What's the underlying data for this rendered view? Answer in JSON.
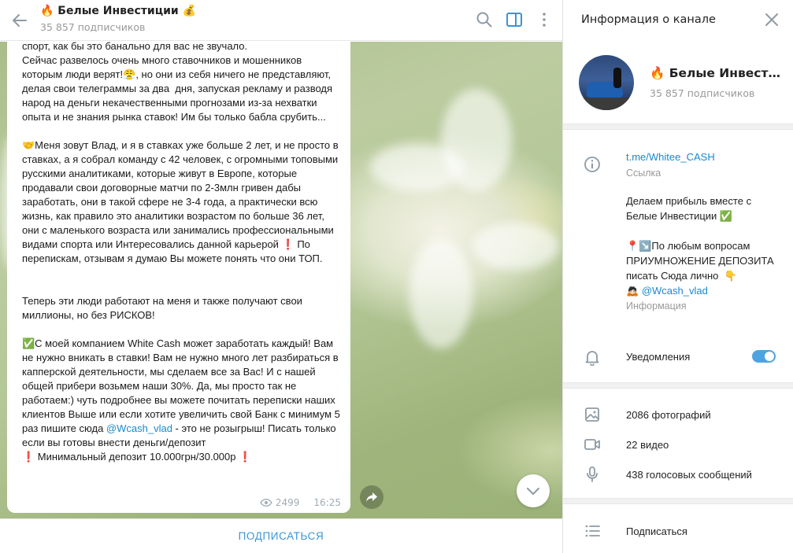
{
  "channel": {
    "title": "🔥 Белые Инвестиции 💰",
    "subscribers": "35 857 подписчиков"
  },
  "header_icons": [
    "back-arrow-icon",
    "search-icon",
    "sidebar-toggle-icon",
    "more-vertical-icon"
  ],
  "message": {
    "text": "спорт, как бы это банально для вас не звучало.\nСейчас развелось очень много ставочников и мошенников которым люди верят!😤, но они из себя ничего не представляют, делая свои телеграммы за два  дня, запуская рекламу и разводя народ на деньги некачественными прогнозами из-за нехватки опыта и не знания рынка ставок! Им бы только бабла срубить...\n\n🤝Меня зовут Влад, и я в ставках уже больше 2 лет, и не просто в ставках, а я собрал команду с 42 человек, с огромными топовыми русскими аналитиками, которые живут в Европе, которые продавали свои договорные матчи по 2-3млн гривен дабы заработать, они в такой сфере не 3-4 года, а практически всю жизнь, как правило это аналитики возрастом по больше 36 лет, они с маленького возраста или занимались профессиональными видами спорта или Интересовались данной карьерой ❗️ По перепискам, отзывам я думаю Вы можете понять что они ТОП.\n\n\nТеперь эти люди работают на меня и также получают свои миллионы, но без РИСКОВ!\n\n✅С моей компанием White Cash может заработать каждый! Вам не нужно вникать в ставки! Вам не нужно много лет разбираться в капперской деятельности, мы сделаем все за Вас! И с нашей общей прибери возьмем наши 30%. Да, мы просто так не работаем:) чуть подробнее вы можете почитать переписки наших клиентов Выше или если хотите увеличить свой Банк с минимум 5 раз пишите сюда ",
    "mention": "@Wcash_vlad",
    "text_after": " - это не розыгрыш! Писать только если вы готовы внести деньги/депозит\n❗️ Минимальный депозит 10.000грн/30.000р ❗️",
    "views": "2499",
    "time": "16:25"
  },
  "subscribe_button": "ПОДПИСАТЬСЯ",
  "info_panel": {
    "title": "Информация о канале",
    "name": "🔥 Белые Инвестиции 💰",
    "subscribers": "35 857 подписчиков",
    "link": "t.me/Whitee_CASH",
    "link_caption": "Ссылка",
    "description_text": "Делаем прибыль вместе с Белые Инвестиции ✅\n\n📍↘️По любым вопросам ПРИУМНОЖЕНИЕ ДЕПОЗИТА писать Сюда лично  👇\n🙇🏻 ",
    "description_mention": "@Wcash_vlad",
    "description_caption": "Информация",
    "notifications_label": "Уведомления",
    "notifications_on": true,
    "media": [
      {
        "icon": "photo-icon",
        "label": "2086 фотографий"
      },
      {
        "icon": "video-icon",
        "label": "22 видео"
      },
      {
        "icon": "microphone-icon",
        "label": "438 голосовых сообщений"
      }
    ],
    "subscribe_label": "Подписаться"
  },
  "colors": {
    "accent": "#168acd",
    "button_text": "#3a95d5",
    "toggle": "#4ea4e0",
    "muted": "#999999"
  }
}
